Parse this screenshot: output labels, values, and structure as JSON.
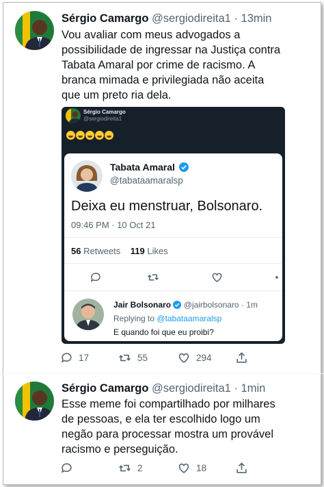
{
  "tweet1": {
    "name": "Sérgio Camargo",
    "handle": "@sergiodireita1",
    "separator": "·",
    "time": "13min",
    "text_lines": [
      "Vou avaliar com meus advogados a",
      "possibilidade de ingressar na Justiça contra",
      "Tabata Amaral por crime de racismo. A",
      "branca mimada e privilegiada não aceita",
      "que um preto ria dela."
    ],
    "replies": "17",
    "retweets": "55",
    "likes": "294"
  },
  "embed": {
    "name": "Sérgio Camargo",
    "handle": "@sergiodireita1",
    "emoji_count": 5,
    "quoted": {
      "name": "Tabata Amaral",
      "handle": "@tabataamaralsp",
      "text": "Deixa eu menstruar, Bolsonaro.",
      "timestamp": "09:46 PM · 10 Oct 21",
      "retweets_count": "56",
      "retweets_label": "Retweets",
      "likes_count": "119",
      "likes_label": "Likes"
    },
    "reply": {
      "name": "Jair Bolsonaro",
      "handle": "@jairbolsonaro",
      "separator": "·",
      "time": "1m",
      "replying_prefix": "Replying to",
      "replying_to": "@tabataamaralsp",
      "text": "E quando foi que eu proibi?"
    }
  },
  "tweet2": {
    "name": "Sérgio Camargo",
    "handle": "@sergiodireita1",
    "separator": "·",
    "time": "1min",
    "text_lines": [
      "Esse meme foi compartilhado por milhares",
      "de pessoas, e ela ter escolhido logo um",
      "negão para processar mostra um provável",
      "racismo e perseguição."
    ],
    "replies": "",
    "retweets": "2",
    "likes": "18"
  },
  "colors": {
    "accent": "#1d9bf0",
    "text": "#0f1419",
    "muted": "#536471",
    "dark_bg": "#15202b"
  },
  "icons": [
    "reply-icon",
    "retweet-icon",
    "like-icon",
    "share-icon",
    "verified-icon"
  ]
}
